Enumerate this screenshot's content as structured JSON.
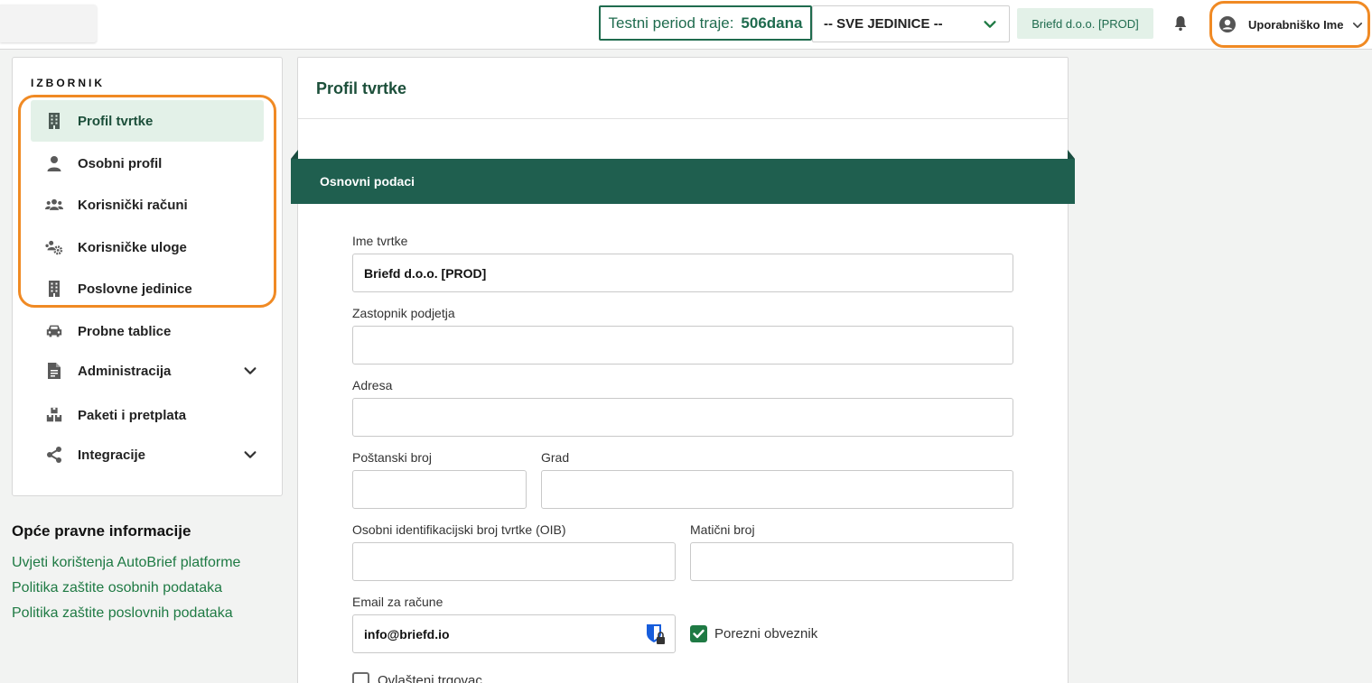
{
  "header": {
    "trial_label": "Testni period traje:",
    "trial_days": "506dana",
    "unit_select_value": "-- SVE JEDINICE --",
    "company_badge": "Briefd d.o.o. [PROD]",
    "username": "Uporabniško Ime"
  },
  "sidebar": {
    "title": "IZBORNIK",
    "items": [
      {
        "label": "Profil tvrtke",
        "icon": "building-icon",
        "active": true
      },
      {
        "label": "Osobni profil",
        "icon": "person-icon"
      },
      {
        "label": "Korisnički računi",
        "icon": "users-icon"
      },
      {
        "label": "Korisničke uloge",
        "icon": "users-gear-icon"
      },
      {
        "label": "Poslovne jedinice",
        "icon": "building-icon"
      },
      {
        "label": "Probne tablice",
        "icon": "car-icon"
      },
      {
        "label": "Administracija",
        "icon": "document-icon",
        "expandable": true
      },
      {
        "label": "Paketi i pretplata",
        "icon": "boxes-icon"
      },
      {
        "label": "Integracije",
        "icon": "share-icon",
        "expandable": true
      }
    ]
  },
  "legal": {
    "title": "Opće pravne informacije",
    "links": [
      "Uvjeti korištenja AutoBrief platforme",
      "Politika zaštite osobnih podataka",
      "Politika zaštite poslovnih podataka"
    ]
  },
  "main": {
    "title": "Profil tvrtke",
    "section_title": "Osnovni podaci",
    "fields": {
      "company_name": {
        "label": "Ime tvrtke",
        "value": "Briefd d.o.o. [PROD]"
      },
      "representative": {
        "label": "Zastopnik podjetja",
        "value": ""
      },
      "address": {
        "label": "Adresa",
        "value": ""
      },
      "postal_code": {
        "label": "Poštanski broj",
        "value": ""
      },
      "city": {
        "label": "Grad",
        "value": ""
      },
      "oib": {
        "label": "Osobni identifikacijski broj tvrtke (OIB)",
        "value": ""
      },
      "registration_number": {
        "label": "Matični broj",
        "value": ""
      },
      "invoice_email": {
        "label": "Email za račune",
        "value": "info@briefd.io"
      }
    },
    "checkboxes": {
      "tax_payer": {
        "label": "Porezni obveznik",
        "checked": true
      },
      "authorized_dealer": {
        "label": "Ovlašteni trgovac",
        "checked": false
      }
    }
  },
  "colors": {
    "brand_green": "#1f6b4e",
    "banner_green": "#1f5f4f",
    "highlight_orange": "#f08a24",
    "active_bg": "#e3f1e8"
  }
}
